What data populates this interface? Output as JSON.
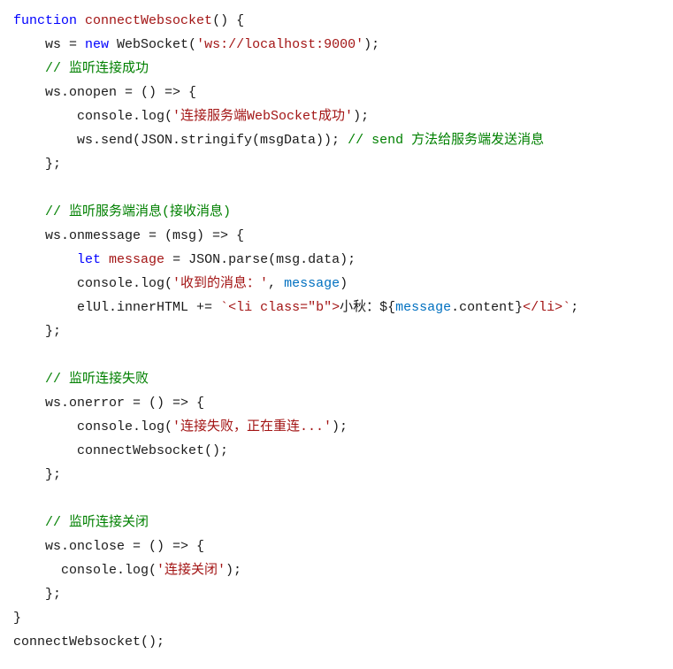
{
  "code": {
    "l1": {
      "function": "function",
      "name": "connectWebsocket",
      "parens": "() {"
    },
    "l2": {
      "pre": "    ws = ",
      "new": "new",
      "ws": " WebSocket(",
      "url": "'ws://localhost:9000'",
      "post": ");"
    },
    "l3": {
      "pre": "    ",
      "cmt": "// 监听连接成功"
    },
    "l4": {
      "txt": "    ws.onopen = () => {"
    },
    "l5": {
      "pre": "        console.log(",
      "str": "'连接服务端WebSocket成功'",
      "post": ");"
    },
    "l6": {
      "pre": "        ws.send(JSON.stringify(msgData)); ",
      "cmt": "// send 方法给服务端发送消息"
    },
    "l7": {
      "txt": "    };"
    },
    "l8": {
      "txt": ""
    },
    "l9": {
      "pre": "    ",
      "cmt": "// 监听服务端消息(接收消息)"
    },
    "l10": {
      "txt": "    ws.onmessage = (msg) => {"
    },
    "l11": {
      "pre": "        ",
      "let": "let",
      "sp": " ",
      "var": "message",
      "mid": " = JSON.parse(msg.data);"
    },
    "l12": {
      "pre": "        console.log(",
      "str": "'收到的消息：'",
      "comma": ", ",
      "var": "message",
      "post": ")"
    },
    "l13": {
      "pre": "        elUl.innerHTML += ",
      "bt1": "`",
      "s1": "<li class=\"b\">",
      "s2": "小秋：",
      "dol": "${",
      "expr": "message",
      "expr2": ".content",
      "rb": "}",
      "s3": "</li>",
      "bt2": "`",
      "post": ";"
    },
    "l14": {
      "txt": "    };"
    },
    "l15": {
      "txt": ""
    },
    "l16": {
      "pre": "    ",
      "cmt": "// 监听连接失败"
    },
    "l17": {
      "txt": "    ws.onerror = () => {"
    },
    "l18": {
      "pre": "        console.log(",
      "str": "'连接失败，正在重连...'",
      "post": ");"
    },
    "l19": {
      "txt": "        connectWebsocket();"
    },
    "l20": {
      "txt": "    };"
    },
    "l21": {
      "txt": ""
    },
    "l22": {
      "pre": "    ",
      "cmt": "// 监听连接关闭"
    },
    "l23": {
      "txt": "    ws.onclose = () => {"
    },
    "l24": {
      "pre": "      console.log(",
      "str": "'连接关闭'",
      "post": ");"
    },
    "l25": {
      "txt": "    };"
    },
    "l26": {
      "txt": "}"
    },
    "l27": {
      "txt": "connectWebsocket();"
    }
  }
}
